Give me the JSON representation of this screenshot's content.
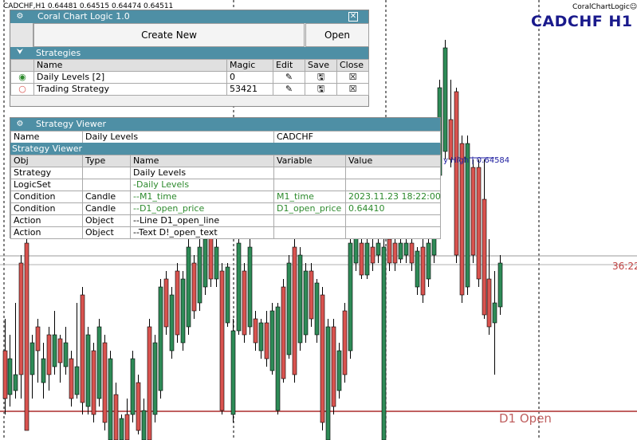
{
  "chart": {
    "symbol_info": "CADCHF,H1  0.64481 0.64515 0.64474 0.64511",
    "brand": "CoralChartLogic☺",
    "symbol_title": "CADCHF H1",
    "price_label": "36:22",
    "d1_open_label": "D1 Open",
    "day_high_label": "y High | 0.64584",
    "colors": {
      "bull": "#2e8b57",
      "bear": "#d9534f",
      "d1_line": "#c06060",
      "grid": "#000000"
    }
  },
  "panel1": {
    "title": "Coral Chart Logic 1.0",
    "menu_icon": "gear-icon",
    "close_icon": "close-icon",
    "create_new_label": "Create New",
    "open_label": "Open",
    "strategies_label": "Strategies",
    "columns": {
      "name": "Name",
      "magic": "Magic",
      "edit": "Edit",
      "save": "Save",
      "close": "Close"
    },
    "rows": [
      {
        "name": "Daily Levels [2]",
        "magic": "0",
        "status": "active"
      },
      {
        "name": "Trading Strategy",
        "magic": "53421",
        "status": "inactive"
      }
    ]
  },
  "panel2": {
    "title": "Strategy Viewer",
    "name_label": "Name",
    "name_value": "Daily Levels",
    "symbol_value": "CADCHF",
    "section_label": "Strategy Viewer",
    "columns": {
      "obj": "Obj",
      "type": "Type",
      "name": "Name",
      "variable": "Variable",
      "value": "Value"
    },
    "rows": [
      {
        "obj": "Strategy",
        "type": "",
        "name": "Daily Levels",
        "variable": "",
        "value": "",
        "green": false
      },
      {
        "obj": "LogicSet",
        "type": "",
        "name": "-Daily Levels",
        "variable": "",
        "value": "",
        "green": true
      },
      {
        "obj": "Condition",
        "type": "Candle",
        "name": "--M1_time",
        "variable": "M1_time",
        "value": "2023.11.23 18:22:00",
        "green": true
      },
      {
        "obj": "Condition",
        "type": "Candle",
        "name": "--D1_open_price",
        "variable": "D1_open_price",
        "value": "0.64410",
        "green": true
      },
      {
        "obj": "Action",
        "type": "Object",
        "name": "--Line D1_open_line",
        "variable": "",
        "value": "",
        "green": false
      },
      {
        "obj": "Action",
        "type": "Object",
        "name": "--Text D!_open_text",
        "variable": "",
        "value": "",
        "green": false
      }
    ]
  }
}
